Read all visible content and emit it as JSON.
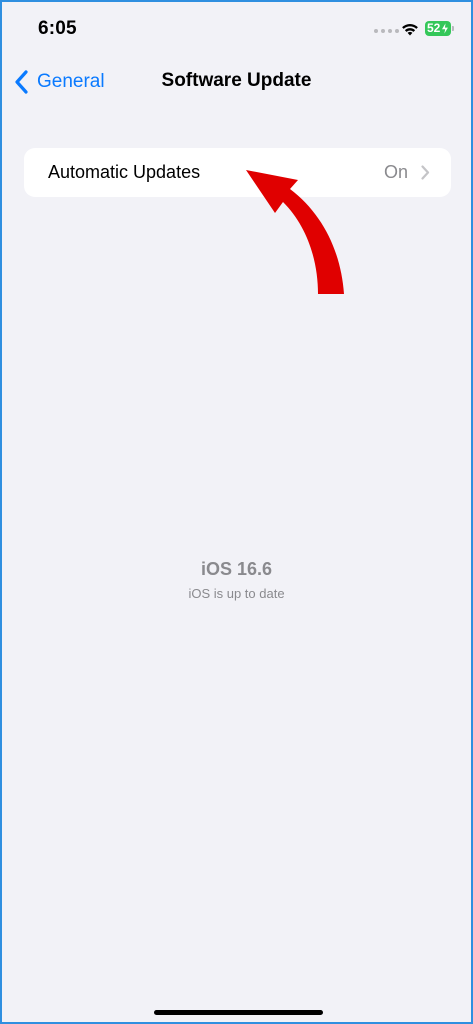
{
  "status_bar": {
    "time": "6:05",
    "battery_level": "52",
    "signal_icon": "signal-dots-icon",
    "wifi_icon": "wifi-icon",
    "charging_icon": "bolt-icon",
    "battery_color": "#34c759"
  },
  "nav": {
    "back_label": "General",
    "title": "Software Update",
    "accent_color": "#0a7aff"
  },
  "automatic_updates": {
    "label": "Automatic Updates",
    "value": "On"
  },
  "software_status": {
    "version": "iOS 16.6",
    "message": "iOS is up to date"
  },
  "annotation": {
    "type": "red-arrow",
    "color": "#e00000"
  }
}
